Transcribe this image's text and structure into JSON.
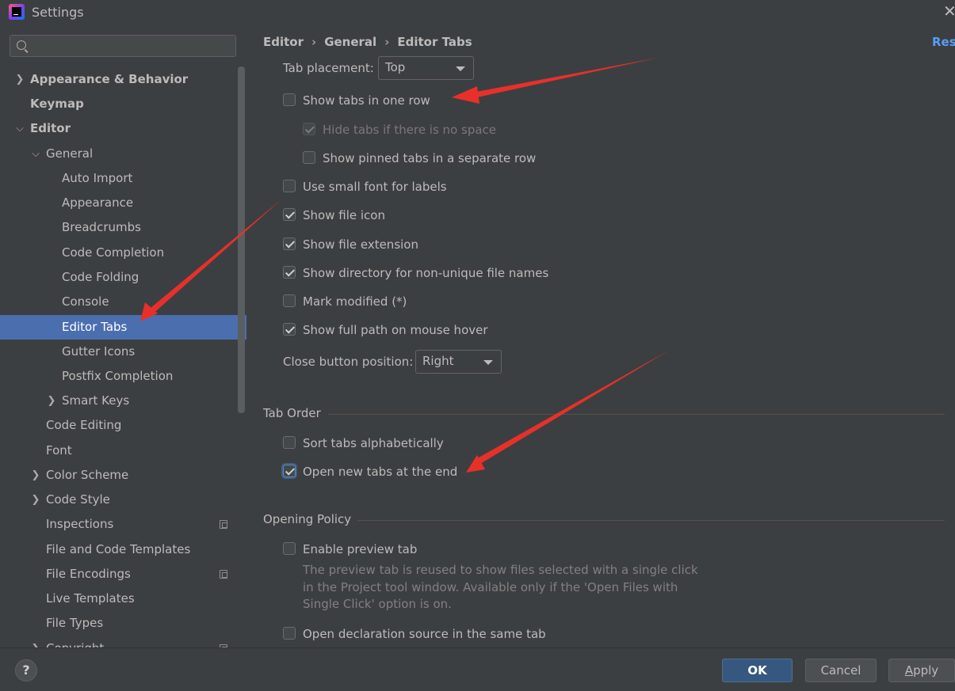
{
  "window": {
    "title": "Settings"
  },
  "sidebar": {
    "search": {
      "value": "",
      "placeholder": ""
    },
    "items": [
      {
        "label": "Appearance & Behavior"
      },
      {
        "label": "Keymap"
      },
      {
        "label": "Editor"
      },
      {
        "label": "General"
      },
      {
        "label": "Auto Import"
      },
      {
        "label": "Appearance"
      },
      {
        "label": "Breadcrumbs"
      },
      {
        "label": "Code Completion"
      },
      {
        "label": "Code Folding"
      },
      {
        "label": "Console"
      },
      {
        "label": "Editor Tabs"
      },
      {
        "label": "Gutter Icons"
      },
      {
        "label": "Postfix Completion"
      },
      {
        "label": "Smart Keys"
      },
      {
        "label": "Code Editing"
      },
      {
        "label": "Font"
      },
      {
        "label": "Color Scheme"
      },
      {
        "label": "Code Style"
      },
      {
        "label": "Inspections"
      },
      {
        "label": "File and Code Templates"
      },
      {
        "label": "File Encodings"
      },
      {
        "label": "Live Templates"
      },
      {
        "label": "File Types"
      },
      {
        "label": "Copyright"
      }
    ]
  },
  "breadcrumb": [
    "Editor",
    "General",
    "Editor Tabs"
  ],
  "reset_label": "Rese",
  "appearance": {
    "tab_placement_label": "Tab placement:",
    "tab_placement_value": "Top",
    "show_tabs_one_row": "Show tabs in one row",
    "hide_tabs_no_space": "Hide tabs if there is no space",
    "show_pinned_separate": "Show pinned tabs in a separate row",
    "small_font": "Use small font for labels",
    "show_file_icon": "Show file icon",
    "show_file_ext": "Show file extension",
    "show_directory": "Show directory for non-unique file names",
    "mark_modified": "Mark modified (*)",
    "show_full_path": "Show full path on mouse hover",
    "close_button_label": "Close button position:",
    "close_button_value": "Right"
  },
  "tab_order": {
    "title": "Tab Order",
    "sort_alpha": "Sort tabs alphabetically",
    "open_at_end": "Open new tabs at the end"
  },
  "opening_policy": {
    "title": "Opening Policy",
    "enable_preview": "Enable preview tab",
    "preview_desc": [
      "The preview tab is reused to show files selected with a single click",
      "in the Project tool window. Available only if the 'Open Files with",
      "Single Click' option is on."
    ],
    "open_declaration": "Open declaration source in the same tab"
  },
  "footer": {
    "help": "?",
    "ok": "OK",
    "cancel": "Cancel",
    "apply_mnemonic": "A",
    "apply_rest": "pply"
  },
  "colors": {
    "background": "#3c3f41",
    "selection": "#4b6eaf",
    "primary_button": "#365880",
    "link": "#589df6",
    "annotation_arrow": "#e8302a"
  }
}
